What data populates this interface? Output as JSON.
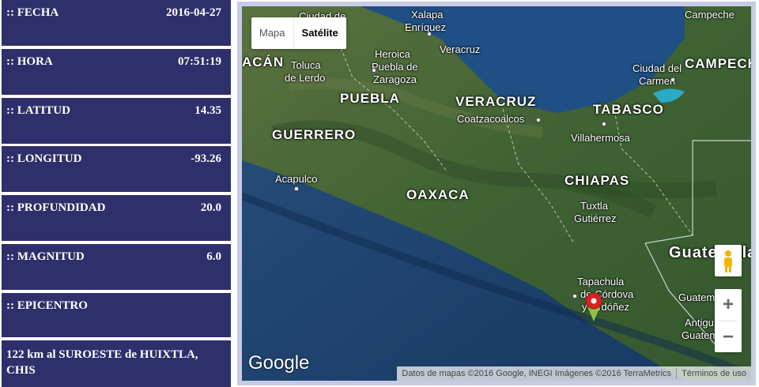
{
  "info": {
    "fecha_label": ":: FECHA",
    "fecha_value": "2016-04-27",
    "hora_label": ":: HORA",
    "hora_value": "07:51:19",
    "latitud_label": ":: LATITUD",
    "latitud_value": "14.35",
    "longitud_label": ":: LONGITUD",
    "longitud_value": "-93.26",
    "profundidad_label": ":: PROFUNDIDAD",
    "profundidad_value": "20.0",
    "magnitud_label": ":: MAGNITUD",
    "magnitud_value": "6.0",
    "epicentro_label": ":: EPICENTRO",
    "epicentro_line1": "122 km al SUROESTE de HUIXTLA,",
    "epicentro_line2": "CHIS"
  },
  "map": {
    "type_map_label": "Mapa",
    "type_satellite_label": "Satélite",
    "zoom_in": "+",
    "zoom_out": "−",
    "logo": "Google",
    "attribution": "Datos de mapas ©2016 Google, INEGI Imágenes ©2016 TerraMetrics",
    "terms": "Términos de uso",
    "labels": {
      "ciudad_de": "Ciudad de",
      "xalapa": "Xalapa",
      "enriquez": "Enríquez",
      "campeche_city": "Campeche",
      "cacan": "ACÁN",
      "toluca": "Toluca",
      "de_lerdo": "de Lerdo",
      "heroica": "Heroica",
      "puebla_de": "Puebla de",
      "zaragoza": "Zaragoza",
      "veracruz_city": "Veracruz",
      "ciudad_del": "Ciudad del",
      "carmen": "Carmen",
      "campeche_state": "CAMPECHE",
      "puebla": "PUEBLA",
      "veracruz": "VERACRUZ",
      "tabasco": "TABASCO",
      "coatzacoalcos": "Coatzacoalcos",
      "guerrero": "GUERRERO",
      "villahermosa": "Villahermosa",
      "acapulco": "Acapulco",
      "chiapas": "CHIAPAS",
      "oaxaca": "OAXACA",
      "tuxtla": "Tuxtla",
      "gutierrez": "Gutiérrez",
      "guatemala_country": "Guatemala",
      "tapachula": "Tapachula",
      "de_cordova": "de Córdova",
      "y_ordonez": "y Ordóñez",
      "guatemala_city": "Guatema",
      "antigua": "Antigu",
      "guatemala_small": "Guatem"
    }
  },
  "colors": {
    "panel_bg": "#2f2f6b",
    "frame": "#c7cbe5",
    "ocean": "#1a3f6b",
    "land": "#4d6b3a",
    "marker": "#d8221f"
  }
}
